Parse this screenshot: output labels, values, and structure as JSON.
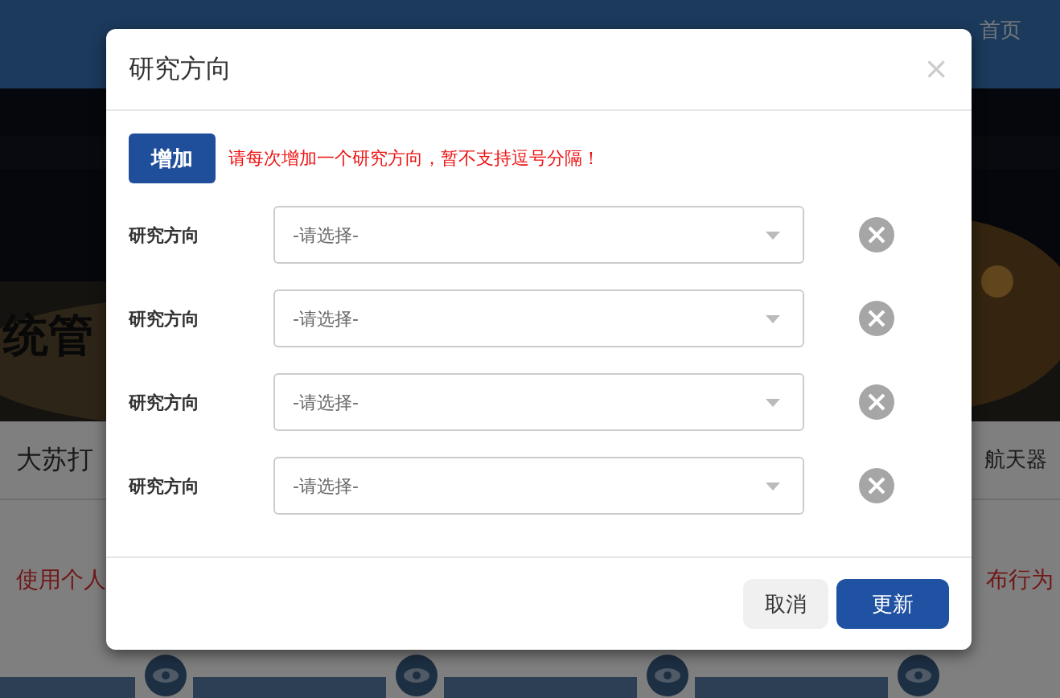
{
  "background": {
    "nav": [
      "首页"
    ],
    "banner_title": "统管",
    "links": [
      "大苏打",
      "航天器"
    ],
    "notices": [
      "使用个人",
      "布行为"
    ]
  },
  "dialog": {
    "title": "研究方向",
    "close": "×",
    "add_button": "增加",
    "hint": "请每次增加一个研究方向，暂不支持逗号分隔！",
    "rows": [
      {
        "label": "研究方向",
        "value": "-请选择-"
      },
      {
        "label": "研究方向",
        "value": "-请选择-"
      },
      {
        "label": "研究方向",
        "value": "-请选择-"
      },
      {
        "label": "研究方向",
        "value": "-请选择-"
      }
    ],
    "buttons": [
      {
        "label": "取消",
        "kind": "secondary"
      },
      {
        "label": "更新",
        "kind": "primary"
      }
    ]
  }
}
